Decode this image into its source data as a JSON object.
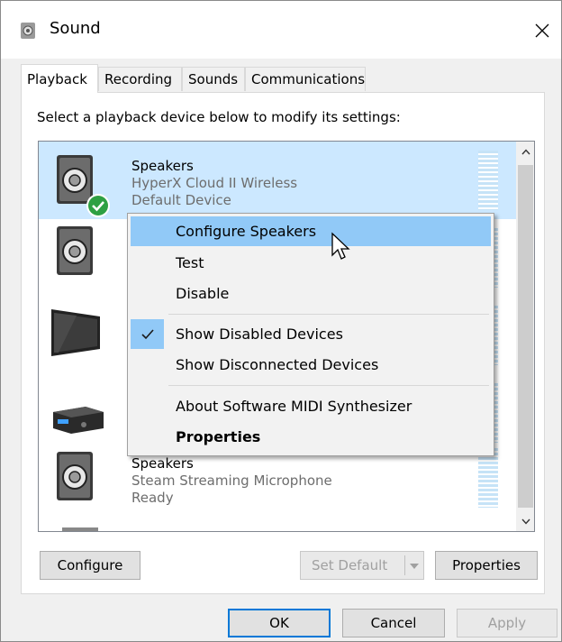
{
  "window": {
    "title": "Sound"
  },
  "tabs": [
    "Playback",
    "Recording",
    "Sounds",
    "Communications"
  ],
  "instruction": "Select a playback device below to modify its settings:",
  "devices": [
    {
      "name": "Speakers",
      "description": "HyperX Cloud II Wireless",
      "status": "Default Device",
      "icon": "speaker-icon"
    },
    {
      "name": "",
      "description": "",
      "status": "",
      "icon": "speaker-icon"
    },
    {
      "name": "",
      "description": "",
      "status": "",
      "icon": "monitor-icon"
    },
    {
      "name": "",
      "description": "",
      "status": "",
      "icon": "receiver-icon"
    },
    {
      "name": "Speakers",
      "description": "Steam Streaming Microphone",
      "status": "Ready",
      "icon": "speaker-icon"
    }
  ],
  "context_menu": {
    "items": {
      "configure": "Configure Speakers",
      "test": "Test",
      "disable": "Disable",
      "show_disabled": "Show Disabled Devices",
      "show_disconnected": "Show Disconnected Devices",
      "about_midi": "About Software MIDI Synthesizer",
      "properties": "Properties"
    },
    "show_disabled_checked": true
  },
  "buttons": {
    "configure": "Configure",
    "set_default": "Set Default",
    "properties": "Properties",
    "ok": "OK",
    "cancel": "Cancel",
    "apply": "Apply"
  },
  "colors": {
    "selection": "#cce8ff",
    "menu_highlight": "#91c9f7",
    "default_check": "#2ea043"
  }
}
